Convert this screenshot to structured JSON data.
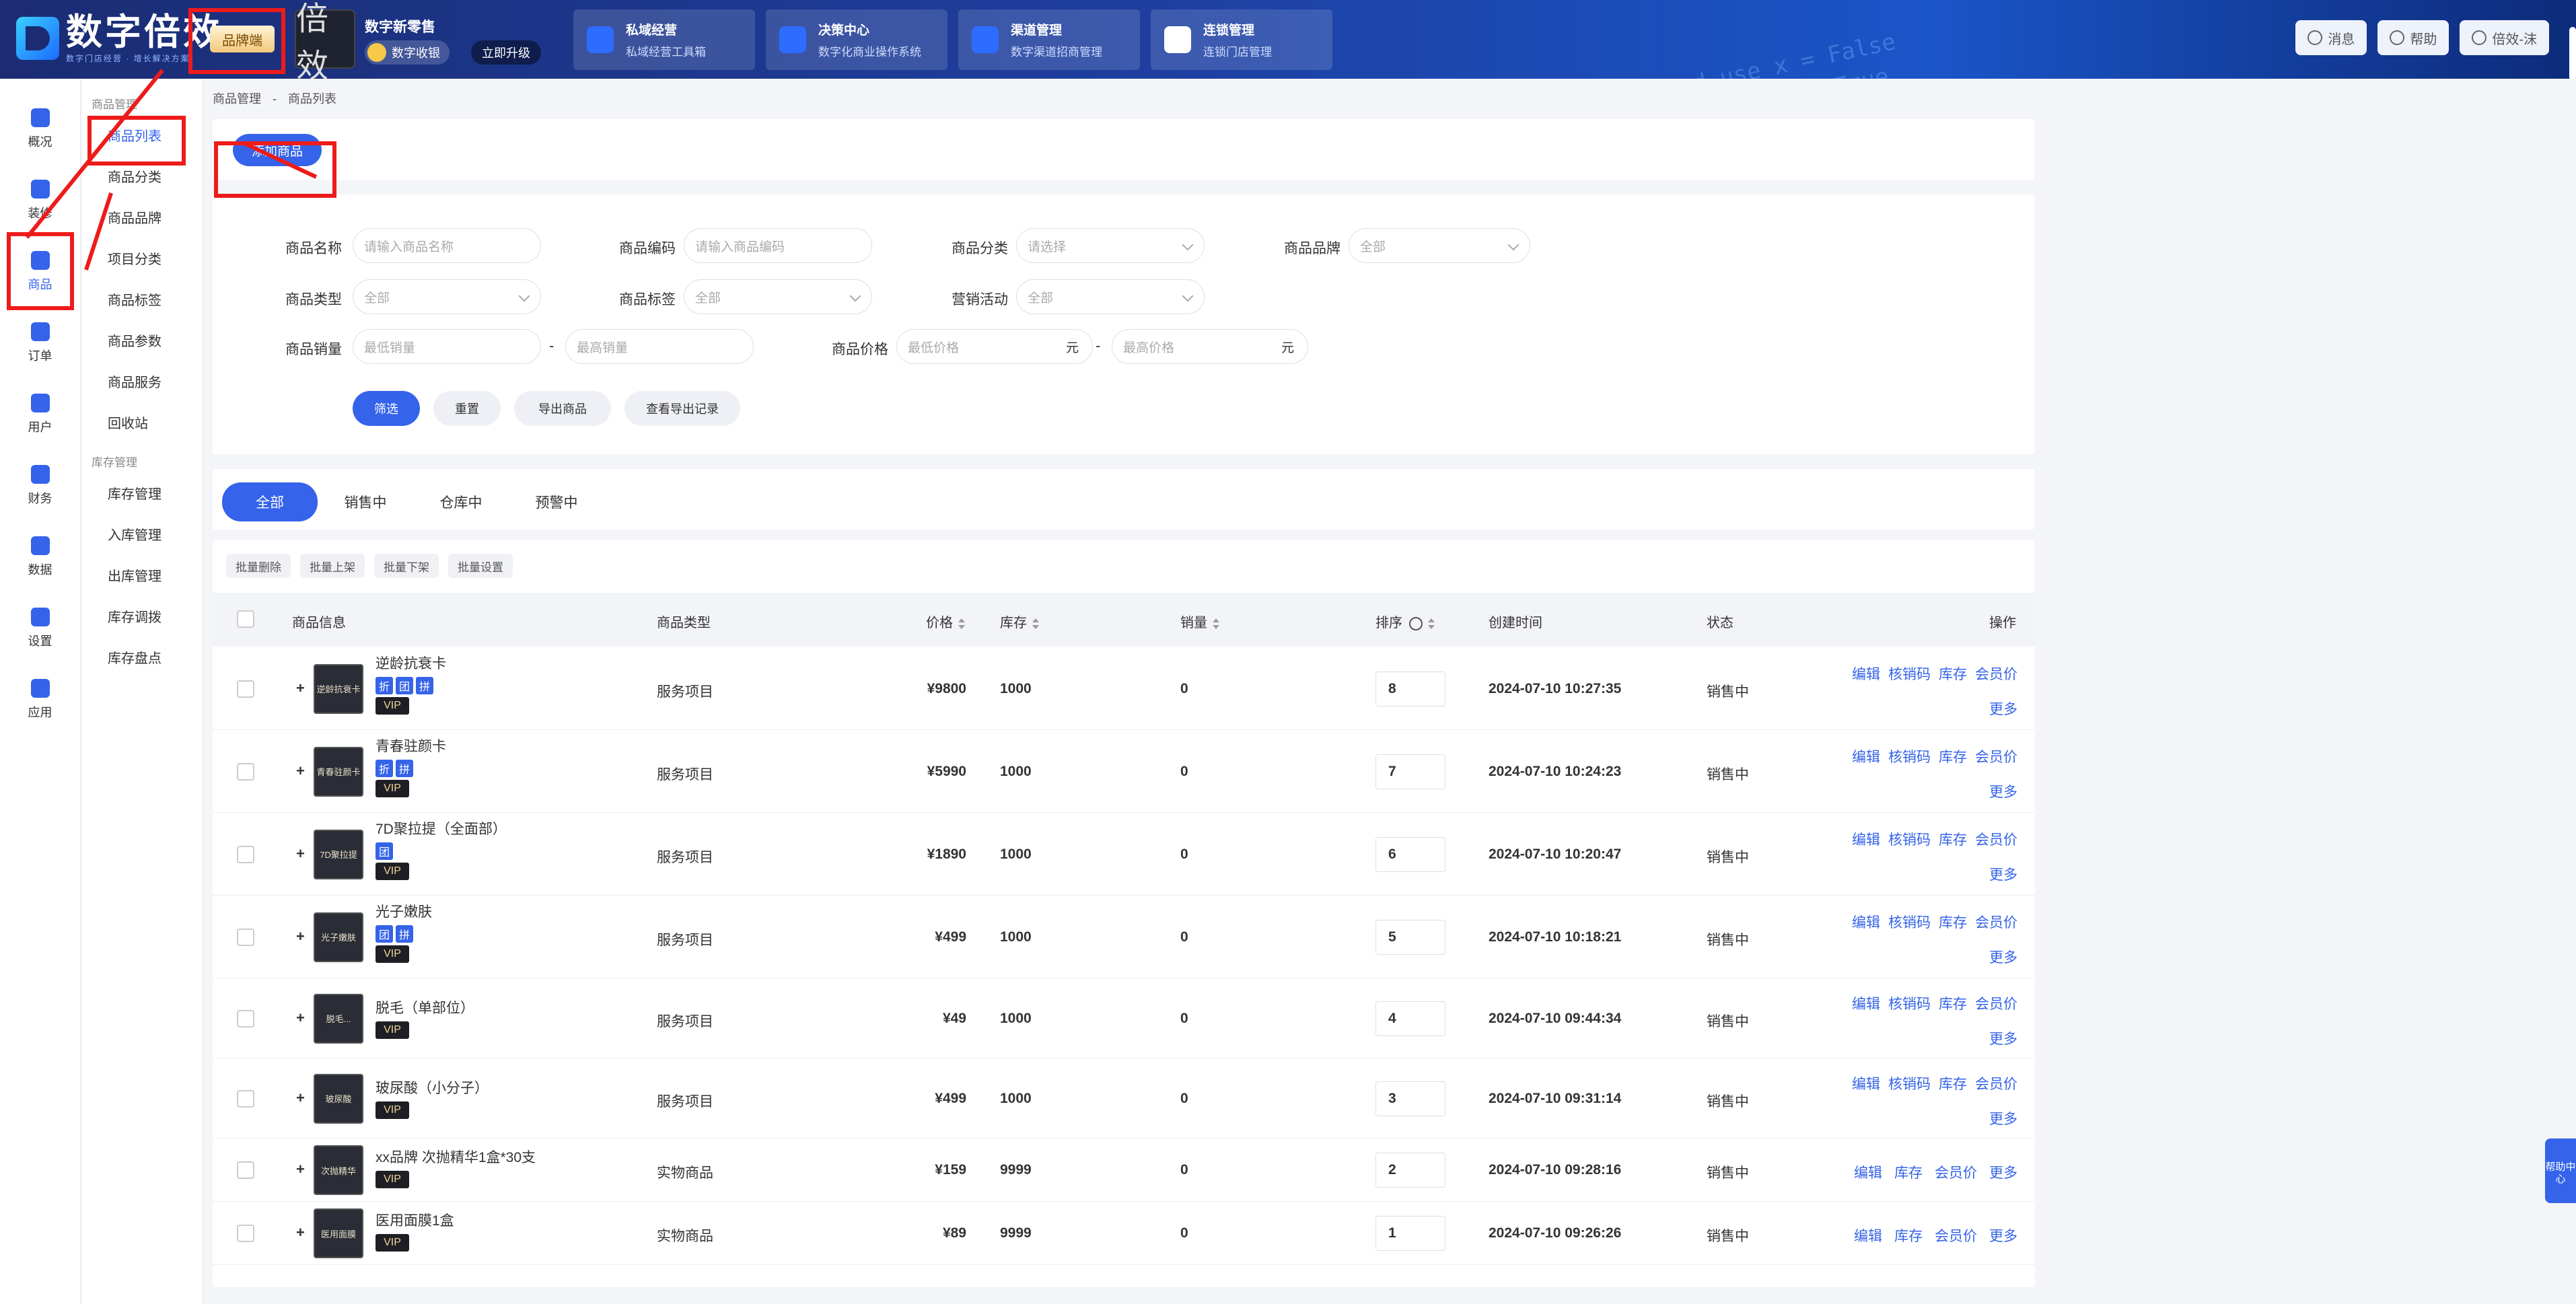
{
  "header": {
    "logo_text": "数字倍效",
    "logo_sub": "数字门店经营 · 增长解决方案",
    "brand_button": "品牌端",
    "store_avatar_text": "倍效",
    "store_name": "数字新零售",
    "store_badge": "数字收银",
    "upgrade": "立即升级",
    "modules": [
      {
        "title": "私域经营",
        "sub": "私域经营工具箱"
      },
      {
        "title": "决策中心",
        "sub": "数字化商业操作系统"
      },
      {
        "title": "渠道管理",
        "sub": "数字渠道招商管理"
      },
      {
        "title": "连锁管理",
        "sub": "连锁门店管理"
      }
    ],
    "messages": "消息",
    "help": "帮助",
    "user": "倍效-沫"
  },
  "leftnav": [
    {
      "label": "概况",
      "icon": "overview-icon"
    },
    {
      "label": "装修",
      "icon": "decorate-icon"
    },
    {
      "label": "商品",
      "icon": "goods-icon"
    },
    {
      "label": "订单",
      "icon": "order-icon"
    },
    {
      "label": "用户",
      "icon": "user-icon"
    },
    {
      "label": "财务",
      "icon": "finance-icon"
    },
    {
      "label": "数据",
      "icon": "data-icon"
    },
    {
      "label": "设置",
      "icon": "settings-icon"
    },
    {
      "label": "应用",
      "icon": "apps-icon"
    }
  ],
  "submenu": {
    "group1": "商品管理",
    "items1": [
      "商品列表",
      "商品分类",
      "商品品牌",
      "项目分类",
      "商品标签",
      "商品参数",
      "商品服务",
      "回收站"
    ],
    "group2": "库存管理",
    "items2": [
      "库存管理",
      "入库管理",
      "出库管理",
      "库存调拨",
      "库存盘点"
    ]
  },
  "breadcrumb": {
    "level1": "商品管理",
    "sep": "-",
    "level2": "商品列表"
  },
  "add_button": "添加商品",
  "filters": {
    "name_label": "商品名称",
    "name_placeholder": "请输入商品名称",
    "code_label": "商品编码",
    "code_placeholder": "请输入商品编码",
    "category_label": "商品分类",
    "category_value": "请选择",
    "brand_label": "商品品牌",
    "brand_value": "全部",
    "type_label": "商品类型",
    "type_value": "全部",
    "tag_label": "商品标签",
    "tag_value": "全部",
    "promo_label": "营销活动",
    "promo_value": "全部",
    "sales_label": "商品销量",
    "sales_min": "最低销量",
    "sales_max": "最高销量",
    "price_label": "商品价格",
    "price_min": "最低价格",
    "price_max": "最高价格",
    "unit": "元",
    "dash": "-",
    "buttons": [
      "筛选",
      "重置",
      "导出商品",
      "查看导出记录"
    ]
  },
  "tabs": [
    "全部",
    "销售中",
    "仓库中",
    "预警中"
  ],
  "bulk_actions": [
    "批量删除",
    "批量上架",
    "批量下架",
    "批量设置"
  ],
  "table": {
    "headers": [
      "商品信息",
      "商品类型",
      "价格",
      "库存",
      "销量",
      "排序",
      "创建时间",
      "状态",
      "操作"
    ],
    "rows": [
      {
        "name": "逆龄抗衰卡",
        "thumb": "逆龄抗衰卡",
        "tags": [
          "折",
          "团",
          "拼"
        ],
        "vip": "VIP",
        "type": "服务项目",
        "price": "¥9800",
        "stock": "1000",
        "sales": "0",
        "sort": "8",
        "time": "2024-07-10 10:27:35",
        "status": "销售中",
        "ops": [
          "编辑",
          "核销码",
          "库存",
          "会员价"
        ],
        "more": "更多"
      },
      {
        "name": "青春驻颜卡",
        "thumb": "青春驻颜卡",
        "tags": [
          "折",
          "拼"
        ],
        "vip": "VIP",
        "type": "服务项目",
        "price": "¥5990",
        "stock": "1000",
        "sales": "0",
        "sort": "7",
        "time": "2024-07-10 10:24:23",
        "status": "销售中",
        "ops": [
          "编辑",
          "核销码",
          "库存",
          "会员价"
        ],
        "more": "更多"
      },
      {
        "name": "7D聚拉提（全面部）",
        "thumb": "7D聚拉提",
        "tags": [
          "团"
        ],
        "vip": "VIP",
        "type": "服务项目",
        "price": "¥1890",
        "stock": "1000",
        "sales": "0",
        "sort": "6",
        "time": "2024-07-10 10:20:47",
        "status": "销售中",
        "ops": [
          "编辑",
          "核销码",
          "库存",
          "会员价"
        ],
        "more": "更多"
      },
      {
        "name": "光子嫩肤",
        "thumb": "光子嫩肤",
        "tags": [
          "团",
          "拼"
        ],
        "vip": "VIP",
        "type": "服务项目",
        "price": "¥499",
        "stock": "1000",
        "sales": "0",
        "sort": "5",
        "time": "2024-07-10 10:18:21",
        "status": "销售中",
        "ops": [
          "编辑",
          "核销码",
          "库存",
          "会员价"
        ],
        "more": "更多"
      },
      {
        "name": "脱毛（单部位）",
        "thumb": "脱毛...",
        "tags": [],
        "vip": "VIP",
        "type": "服务项目",
        "price": "¥49",
        "stock": "1000",
        "sales": "0",
        "sort": "4",
        "time": "2024-07-10 09:44:34",
        "status": "销售中",
        "ops": [
          "编辑",
          "核销码",
          "库存",
          "会员价"
        ],
        "more": "更多"
      },
      {
        "name": "玻尿酸（小分子）",
        "thumb": "玻尿酸",
        "tags": [],
        "vip": "VIP",
        "type": "服务项目",
        "price": "¥499",
        "stock": "1000",
        "sales": "0",
        "sort": "3",
        "time": "2024-07-10 09:31:14",
        "status": "销售中",
        "ops": [
          "编辑",
          "核销码",
          "库存",
          "会员价"
        ],
        "more": "更多"
      },
      {
        "name": "xx品牌 次抛精华1盒*30支",
        "thumb": "次抛精华",
        "tags": [],
        "vip": "VIP",
        "type": "实物商品",
        "price": "¥159",
        "stock": "9999",
        "sales": "0",
        "sort": "2",
        "time": "2024-07-10 09:28:16",
        "status": "销售中",
        "ops": [
          "编辑",
          "库存",
          "会员价",
          "更多"
        ],
        "more": ""
      },
      {
        "name": "医用面膜1盒",
        "thumb": "医用面膜",
        "tags": [],
        "vip": "VIP",
        "type": "实物商品",
        "price": "¥89",
        "stock": "9999",
        "sales": "0",
        "sort": "1",
        "time": "2024-07-10 09:26:26",
        "status": "销售中",
        "ops": [
          "编辑",
          "库存",
          "会员价",
          "更多"
        ],
        "more": ""
      }
    ]
  },
  "help_float": "帮助中心"
}
